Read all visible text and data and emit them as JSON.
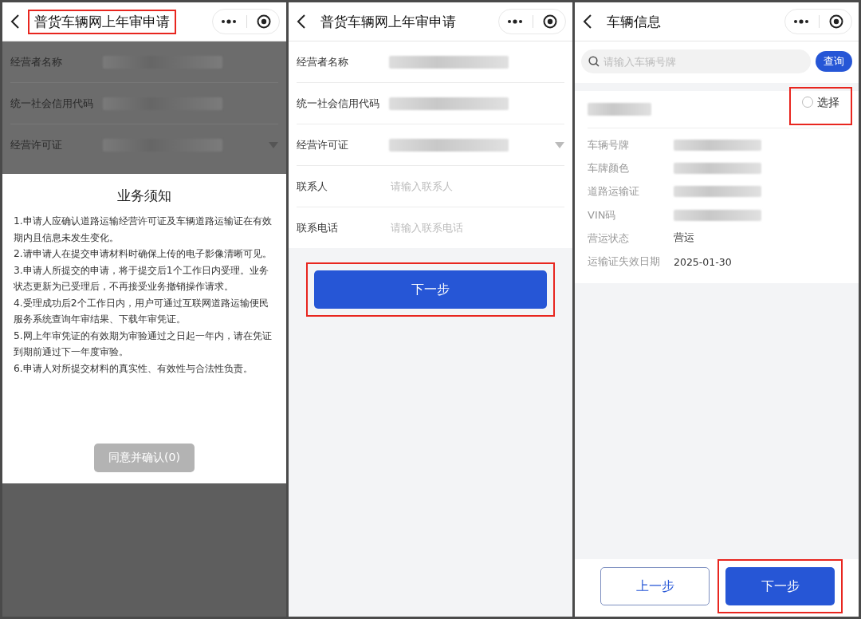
{
  "screens": [
    {
      "kind": "notice",
      "title": "普货车辆网上年审申请",
      "title_highlighted": true,
      "fields": [
        {
          "label": "经营者名称",
          "kind": "text",
          "value_hidden": true
        },
        {
          "label": "统一社会信用代码",
          "kind": "text",
          "value_hidden": true
        },
        {
          "label": "经营许可证",
          "kind": "select",
          "value_hidden": true
        }
      ],
      "notice": {
        "title": "业务须知",
        "items": [
          "1.申请人应确认道路运输经营许可证及车辆道路运输证在有效期内且信息未发生变化。",
          "2.请申请人在提交申请材料时确保上传的电子影像清晰可见。",
          "3.申请人所提交的申请，将于提交后1个工作日内受理。业务状态更新为已受理后，不再接受业务撤销操作请求。",
          "4.受理成功后2个工作日内，用户可通过互联网道路运输便民服务系统查询年审结果、下载年审凭证。",
          "5.网上年审凭证的有效期为审验通过之日起一年内，请在凭证到期前通过下一年度审验。",
          "6.申请人对所提交材料的真实性、有效性与合法性负责。"
        ],
        "button": {
          "label": "同意并确认(0)",
          "disabled": true
        }
      }
    },
    {
      "kind": "form",
      "title": "普货车辆网上年审申请",
      "title_highlighted": false,
      "fields": [
        {
          "label": "经营者名称",
          "kind": "text",
          "value_hidden": true
        },
        {
          "label": "统一社会信用代码",
          "kind": "text",
          "value_hidden": true
        },
        {
          "label": "经营许可证",
          "kind": "select",
          "value_hidden": true
        },
        {
          "label": "联系人",
          "kind": "input",
          "placeholder": "请输入联系人"
        },
        {
          "label": "联系电话",
          "kind": "input",
          "placeholder": "请输入联系电话"
        }
      ],
      "buttons": [
        {
          "label": "下一步",
          "kind": "primary",
          "highlighted": true
        }
      ]
    },
    {
      "kind": "vehicle",
      "title": "车辆信息",
      "title_highlighted": false,
      "search": {
        "placeholder": "请输入车辆号牌"
      },
      "search_button": "查询",
      "card": {
        "name_hidden": true,
        "select_label": "选择",
        "selected": false,
        "select_highlighted": true,
        "details": [
          {
            "label": "车辆号牌",
            "value_hidden": true
          },
          {
            "label": "车牌颜色",
            "value_hidden": true
          },
          {
            "label": "道路运输证",
            "value_hidden": true
          },
          {
            "label": "VIN码",
            "value_hidden": true
          },
          {
            "label": "营运状态",
            "value": "营运"
          },
          {
            "label": "运输证失效日期",
            "value": "2025-01-30"
          }
        ]
      },
      "buttons": [
        {
          "label": "上一步",
          "kind": "secondary",
          "highlighted": false
        },
        {
          "label": "下一步",
          "kind": "primary",
          "highlighted": true
        }
      ]
    }
  ]
}
